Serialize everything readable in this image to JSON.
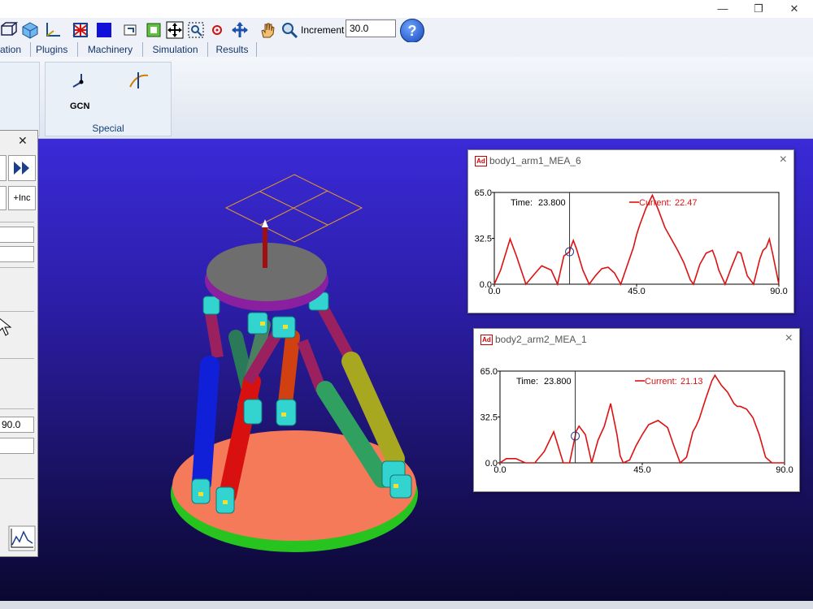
{
  "window": {
    "minimize": "—",
    "maximize": "❐",
    "close": "✕"
  },
  "toolbar": {
    "increment_label": "Increment",
    "increment_value": "30.0",
    "help_label": "?"
  },
  "tabs": [
    "ation",
    "Plugins",
    "Machinery",
    "Simulation",
    "Results"
  ],
  "ribbon": {
    "gcn_label": "GCN",
    "group_label": "Special"
  },
  "left_panel": {
    "close": "✕",
    "inc_button": "+Inc",
    "field_value": "90.0"
  },
  "colors": {
    "viewport_top": "#3a2ad8",
    "viewport_bottom": "#0a0830",
    "curve": "#dd1111",
    "base_plate": "#f47a5a",
    "top_plate": "#6e6e6e"
  },
  "graphs": [
    {
      "title": "body1_arm1_MEA_6",
      "time_label": "Time:",
      "time_value": "23.800",
      "current_label": "Current:",
      "current_value": "22.47",
      "y_ticks": [
        "65.0",
        "32.5",
        "0.0"
      ],
      "x_ticks": [
        "0.0",
        "45.0",
        "90.0"
      ],
      "chart_data": {
        "type": "line",
        "xlim": [
          0,
          90
        ],
        "ylim": [
          0,
          65
        ],
        "cursor_x": 23.8,
        "series": [
          {
            "x": [
              0,
              2,
              5,
              7,
              10,
              13,
              15,
              18,
              20,
              22,
              23.8,
              24,
              25,
              26,
              28,
              30,
              32,
              34,
              36,
              38,
              40,
              42,
              44,
              45,
              46,
              48,
              50,
              52,
              54,
              56,
              58,
              60,
              62,
              63,
              65,
              67,
              69,
              70,
              71,
              73,
              75,
              77,
              78,
              80,
              82,
              84,
              85,
              86,
              87,
              88,
              90
            ],
            "y": [
              0,
              10,
              32,
              20,
              0,
              8,
              13,
              10,
              0,
              20,
              23,
              25,
              31,
              25,
              10,
              0,
              6,
              11,
              12,
              8,
              0,
              13,
              26,
              35,
              42,
              54,
              63,
              52,
              40,
              32,
              24,
              15,
              3,
              0,
              14,
              22,
              24,
              18,
              10,
              0,
              12,
              23,
              22,
              6,
              0,
              18,
              24,
              26,
              32,
              22,
              0
            ]
          }
        ]
      }
    },
    {
      "title": "body2_arm2_MEA_1",
      "time_label": "Time:",
      "time_value": "23.800",
      "current_label": "Current:",
      "current_value": "21.13",
      "y_ticks": [
        "65.0",
        "32.5",
        "0.0"
      ],
      "x_ticks": [
        "0.0",
        "45.0",
        "90.0"
      ],
      "chart_data": {
        "type": "line",
        "xlim": [
          0,
          90
        ],
        "ylim": [
          0,
          65
        ],
        "cursor_x": 23.8,
        "series": [
          {
            "x": [
              0,
              2,
              5,
              8,
              11,
              14,
              17,
              20,
              22,
              23.8,
              24,
              25,
              27,
              29,
              31,
              33,
              35,
              37,
              38,
              39,
              41,
              43,
              45,
              47,
              50,
              53,
              55,
              57,
              59,
              61,
              62,
              63,
              65,
              67,
              68,
              70,
              72,
              74,
              75,
              76,
              78,
              80,
              82,
              84,
              86,
              87,
              88,
              90
            ],
            "y": [
              0,
              3,
              3,
              0,
              0,
              8,
              22,
              0,
              0,
              19,
              22,
              26,
              20,
              0,
              16,
              26,
              42,
              20,
              5,
              0,
              2,
              12,
              20,
              27,
              30,
              25,
              12,
              0,
              4,
              22,
              26,
              31,
              45,
              58,
              62,
              55,
              50,
              42,
              40,
              40,
              38,
              32,
              20,
              4,
              0,
              0,
              0,
              0
            ]
          }
        ]
      }
    }
  ]
}
